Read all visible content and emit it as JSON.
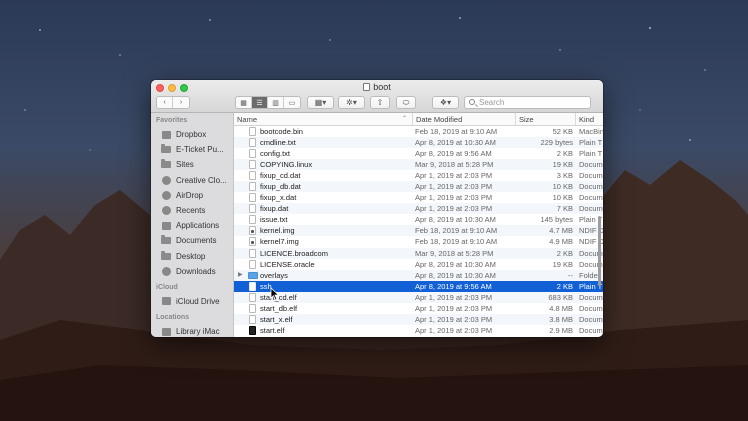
{
  "window": {
    "title": "boot"
  },
  "toolbar": {
    "search_placeholder": "Search"
  },
  "sidebar": {
    "favorites_header": "Favorites",
    "favorites": [
      {
        "label": "Dropbox",
        "icon": "dropbox-icon"
      },
      {
        "label": "E-Ticket Pu...",
        "icon": "folder-icon"
      },
      {
        "label": "Sites",
        "icon": "folder-icon"
      },
      {
        "label": "Creative Clo...",
        "icon": "creative-cloud-icon"
      },
      {
        "label": "AirDrop",
        "icon": "airdrop-icon"
      },
      {
        "label": "Recents",
        "icon": "clock-icon"
      },
      {
        "label": "Applications",
        "icon": "applications-icon"
      },
      {
        "label": "Documents",
        "icon": "documents-icon"
      },
      {
        "label": "Desktop",
        "icon": "desktop-icon"
      },
      {
        "label": "Downloads",
        "icon": "downloads-icon"
      }
    ],
    "icloud_header": "iCloud",
    "icloud": [
      {
        "label": "iCloud Drive",
        "icon": "cloud-icon"
      }
    ],
    "locations_header": "Locations",
    "locations": [
      {
        "label": "Library iMac",
        "icon": "imac-icon"
      }
    ]
  },
  "columns": {
    "name": "Name",
    "date": "Date Modified",
    "size": "Size",
    "kind": "Kind"
  },
  "files": [
    {
      "name": "bootcode.bin",
      "date": "Feb 18, 2019 at 9:10 AM",
      "size": "52 KB",
      "kind": "MacBin",
      "icon": "file"
    },
    {
      "name": "cmdline.txt",
      "date": "Apr 8, 2019 at 10:30 AM",
      "size": "229 bytes",
      "kind": "Plain T",
      "icon": "file"
    },
    {
      "name": "config.txt",
      "date": "Apr 8, 2019 at 9:56 AM",
      "size": "2 KB",
      "kind": "Plain T",
      "icon": "file"
    },
    {
      "name": "COPYING.linux",
      "date": "Mar 9, 2018 at 5:28 PM",
      "size": "19 KB",
      "kind": "Docum",
      "icon": "file"
    },
    {
      "name": "fixup_cd.dat",
      "date": "Apr 1, 2019 at 2:03 PM",
      "size": "3 KB",
      "kind": "Docum",
      "icon": "file"
    },
    {
      "name": "fixup_db.dat",
      "date": "Apr 1, 2019 at 2:03 PM",
      "size": "10 KB",
      "kind": "Docum",
      "icon": "file"
    },
    {
      "name": "fixup_x.dat",
      "date": "Apr 1, 2019 at 2:03 PM",
      "size": "10 KB",
      "kind": "Docum",
      "icon": "file"
    },
    {
      "name": "fixup.dat",
      "date": "Apr 1, 2019 at 2:03 PM",
      "size": "7 KB",
      "kind": "Docum",
      "icon": "file"
    },
    {
      "name": "issue.txt",
      "date": "Apr 8, 2019 at 10:30 AM",
      "size": "145 bytes",
      "kind": "Plain T",
      "icon": "file"
    },
    {
      "name": "kernel.img",
      "date": "Feb 18, 2019 at 9:10 AM",
      "size": "4.7 MB",
      "kind": "NDIF D",
      "icon": "lock"
    },
    {
      "name": "kernel7.img",
      "date": "Feb 18, 2019 at 9:10 AM",
      "size": "4.9 MB",
      "kind": "NDIF D",
      "icon": "lock"
    },
    {
      "name": "LICENCE.broadcom",
      "date": "Mar 9, 2018 at 5:28 PM",
      "size": "2 KB",
      "kind": "Docum",
      "icon": "file"
    },
    {
      "name": "LICENSE.oracle",
      "date": "Apr 8, 2019 at 10:30 AM",
      "size": "19 KB",
      "kind": "Docum",
      "icon": "file"
    },
    {
      "name": "overlays",
      "date": "Apr 8, 2019 at 10:30 AM",
      "size": "--",
      "kind": "Folder",
      "icon": "folder"
    },
    {
      "name": "ssh",
      "date": "Apr 8, 2019 at 9:56 AM",
      "size": "2 KB",
      "kind": "Plain T",
      "icon": "file",
      "selected": true
    },
    {
      "name": "start_cd.elf",
      "date": "Apr 1, 2019 at 2:03 PM",
      "size": "683 KB",
      "kind": "Docum",
      "icon": "file"
    },
    {
      "name": "start_db.elf",
      "date": "Apr 1, 2019 at 2:03 PM",
      "size": "4.8 MB",
      "kind": "Docum",
      "icon": "file"
    },
    {
      "name": "start_x.elf",
      "date": "Apr 1, 2019 at 2:03 PM",
      "size": "3.8 MB",
      "kind": "Docum",
      "icon": "file"
    },
    {
      "name": "start.elf",
      "date": "Apr 1, 2019 at 2:03 PM",
      "size": "2.9 MB",
      "kind": "Docum",
      "icon": "exec"
    }
  ]
}
